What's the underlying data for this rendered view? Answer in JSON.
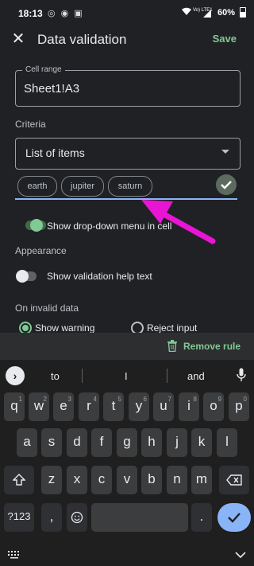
{
  "status_bar": {
    "time": "18:13",
    "battery": "60%",
    "network": "Vo) LTE1",
    "icons": [
      "notification-icons",
      "wifi-icon",
      "signal-icon",
      "battery-icon"
    ]
  },
  "app_bar": {
    "title": "Data validation",
    "save_label": "Save",
    "close_icon": "close-icon"
  },
  "cell_range": {
    "label": "Cell range",
    "value": "Sheet1!A3"
  },
  "criteria": {
    "section_label": "Criteria",
    "selected": "List of items",
    "items": [
      "earth",
      "jupiter",
      "saturn"
    ]
  },
  "options": {
    "dropdown_toggle_label": "Show drop-down menu in cell",
    "dropdown_toggle_on": true,
    "appearance_label": "Appearance",
    "help_text_label": "Show validation help text",
    "help_text_on": false,
    "invalid_data_label": "On invalid data",
    "show_warning": "Show warning",
    "reject_input": "Reject input"
  },
  "bottom_action": {
    "remove_rule_label": "Remove rule"
  },
  "keyboard": {
    "suggestions": [
      "to",
      "I",
      "and"
    ],
    "row1": [
      "q",
      "w",
      "e",
      "r",
      "t",
      "y",
      "u",
      "i",
      "o",
      "p"
    ],
    "row1_hints": [
      "1",
      "2",
      "3",
      "4",
      "5",
      "6",
      "7",
      "8",
      "9",
      "0"
    ],
    "row2": [
      "a",
      "s",
      "d",
      "f",
      "g",
      "h",
      "j",
      "k",
      "l"
    ],
    "row3": [
      "z",
      "x",
      "c",
      "v",
      "b",
      "n",
      "m"
    ],
    "mode_key": "?123",
    "comma": ",",
    "period": "."
  },
  "colors": {
    "accent_green": "#81c995",
    "annotation_arrow": "#e815d5",
    "input_underline": "#8ab4f8"
  }
}
